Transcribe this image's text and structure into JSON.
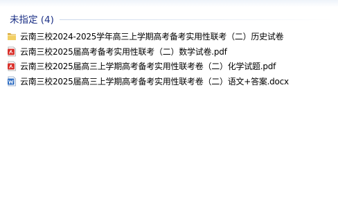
{
  "group": {
    "title": "未指定 (4)"
  },
  "files": [
    {
      "name": "云南三校2024-2025学年高三上学期高考备考实用性联考（二）历史试卷",
      "icon": "folder-icon"
    },
    {
      "name": "云南三校2025届高考备考实用性联考（二）数学试卷.pdf",
      "icon": "pdf-icon"
    },
    {
      "name": "云南三校2025届高三上学期高考备考实用性联考卷（二）化学试题.pdf",
      "icon": "pdf-icon"
    },
    {
      "name": "云南三校2025届高三上学期高考备考实用性联考卷（二）语文+答案.docx",
      "icon": "word-doc-icon"
    }
  ],
  "colors": {
    "group_title": "#1e3287",
    "folder": "#e8c04f",
    "pdf": "#d9312b",
    "word": "#2b6bc2"
  }
}
